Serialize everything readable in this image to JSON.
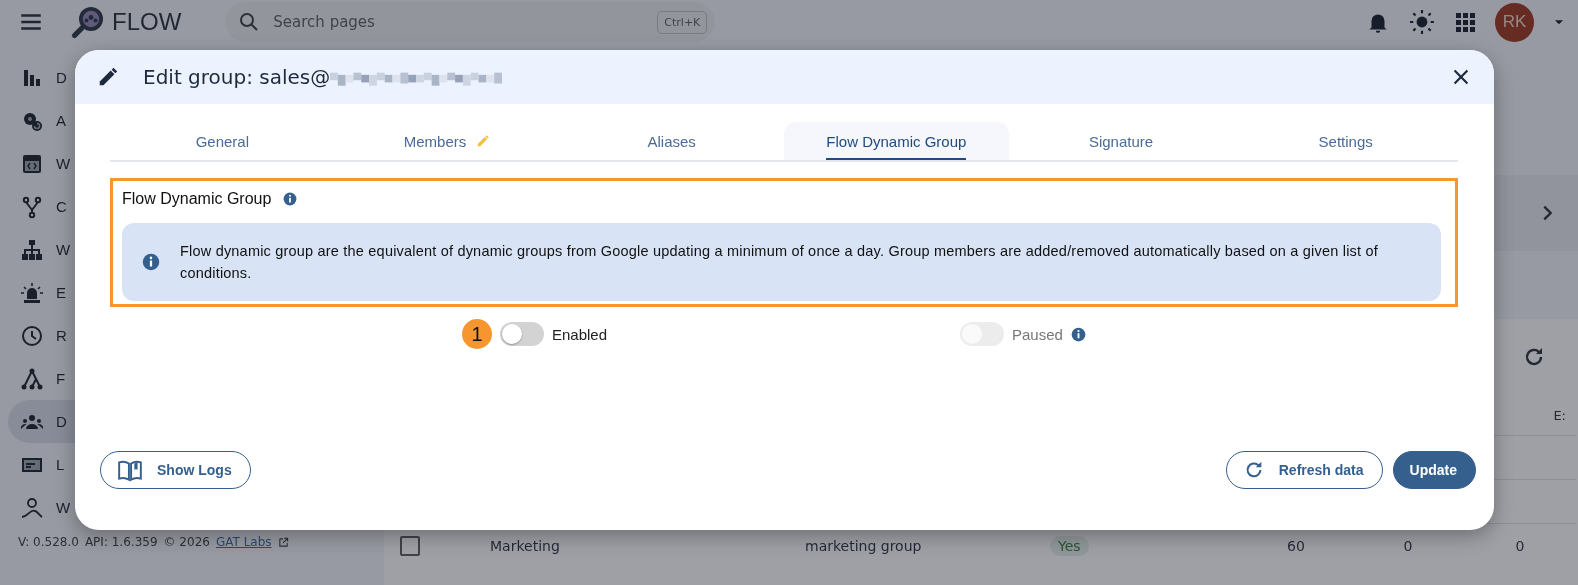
{
  "topbar": {
    "logo_text": "FLOW",
    "search": {
      "placeholder": "Search pages",
      "shortcut": "Ctrl+K"
    },
    "avatar": "RK"
  },
  "sidebar": {
    "items": [
      {
        "label": "D",
        "selected": false
      },
      {
        "label": "A",
        "selected": false
      },
      {
        "label": "W",
        "selected": false
      },
      {
        "label": "C",
        "selected": false
      },
      {
        "label": "W",
        "selected": false
      },
      {
        "label": "E",
        "selected": false
      },
      {
        "label": "R",
        "selected": false
      },
      {
        "label": "F",
        "selected": false
      },
      {
        "label": "D",
        "selected": true
      },
      {
        "label": "L",
        "selected": false
      },
      {
        "label": "W",
        "selected": false
      }
    ]
  },
  "footer": {
    "version": "V: 0.528.0",
    "api": "API: 1.6.359",
    "copyright": "© 2026",
    "link": "GAT Labs"
  },
  "table": {
    "header_last": "E:",
    "rows": [
      {
        "checked": false,
        "name": "Marketing",
        "description": "marketing group",
        "status": "Yes",
        "column_4": "60",
        "column_5": "0",
        "column_6": "0"
      }
    ]
  },
  "modal": {
    "title": "Edit group: sales@",
    "tabs": [
      {
        "label": "General",
        "selected": false,
        "edited": false
      },
      {
        "label": "Members",
        "selected": false,
        "edited": true
      },
      {
        "label": "Aliases",
        "selected": false,
        "edited": false
      },
      {
        "label": "Flow Dynamic Group",
        "selected": true,
        "edited": false
      },
      {
        "label": "Signature",
        "selected": false,
        "edited": false
      },
      {
        "label": "Settings",
        "selected": false,
        "edited": false
      }
    ],
    "section": {
      "title": "Flow Dynamic Group",
      "highlighted": true,
      "info": "Flow dynamic group are the equivalent of dynamic groups from Google updating a minimum of once a day. Group members are added/removed automatically based on a given list of conditions."
    },
    "toggles": [
      {
        "label": "Enabled",
        "on": false,
        "disabled": false,
        "badge": "1",
        "info": false
      },
      {
        "label": "Paused",
        "on": false,
        "disabled": true,
        "info": true
      }
    ],
    "buttons": [
      {
        "label": "Show Logs",
        "kind": "outline"
      },
      {
        "label": "Refresh data",
        "kind": "outline"
      },
      {
        "label": "Update",
        "kind": "primary"
      }
    ]
  }
}
